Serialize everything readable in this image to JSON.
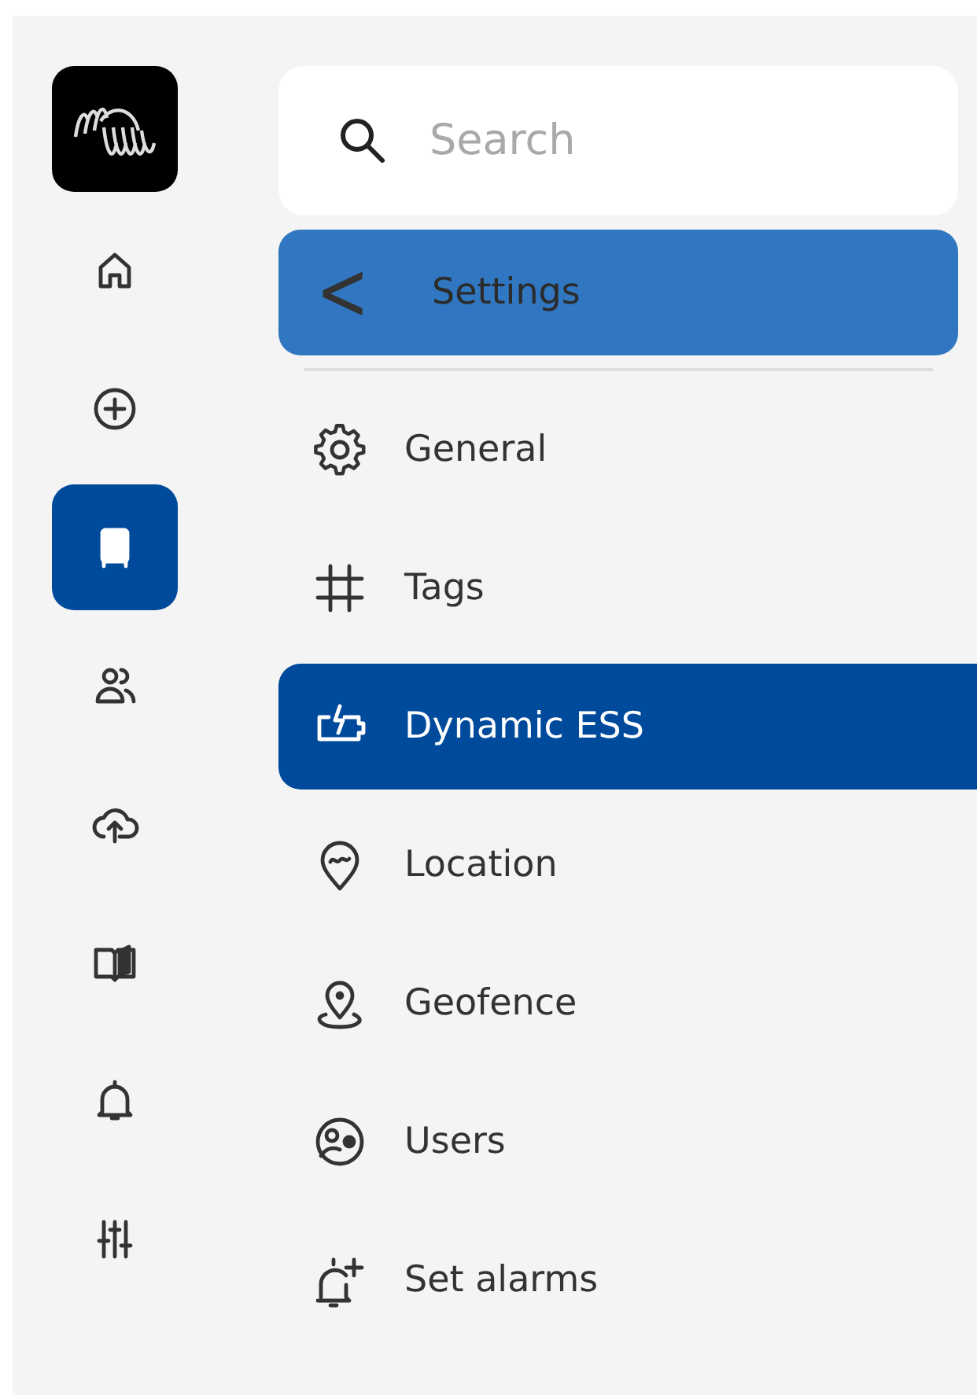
{
  "rail": {
    "items": [
      {
        "selected": false
      },
      {
        "selected": false
      },
      {
        "selected": true
      },
      {
        "selected": false
      },
      {
        "selected": false
      },
      {
        "selected": false
      },
      {
        "selected": false
      },
      {
        "selected": false
      }
    ]
  },
  "search": {
    "placeholder": "Search"
  },
  "header": {
    "back": "<",
    "title": "Settings"
  },
  "menu": [
    {
      "label": "General",
      "selected": false
    },
    {
      "label": "Tags",
      "selected": false
    },
    {
      "label": "Dynamic ESS",
      "selected": true
    },
    {
      "label": "Location",
      "selected": false
    },
    {
      "label": "Geofence",
      "selected": false
    },
    {
      "label": "Users",
      "selected": false
    },
    {
      "label": "Set alarms",
      "selected": false
    }
  ]
}
